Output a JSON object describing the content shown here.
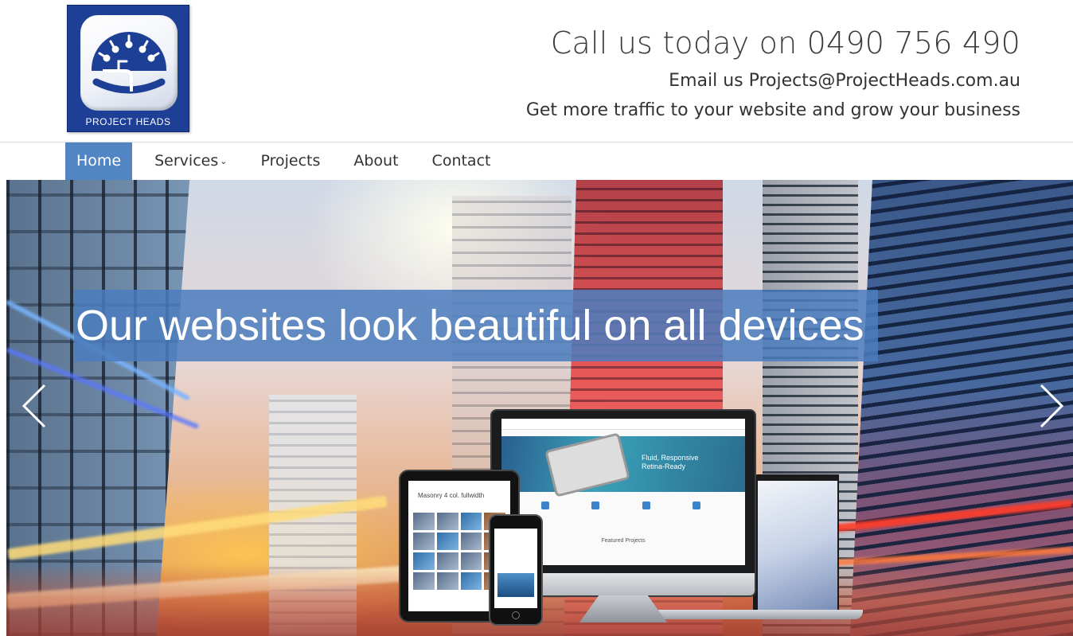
{
  "header": {
    "logo_text": "PROJECT HEADS",
    "phone_line": "Call us today on 0490 756 490",
    "email_line": "Email us Projects@ProjectHeads.com.au",
    "tagline": "Get more traffic to your website and grow your business"
  },
  "nav": {
    "items": [
      {
        "label": "Home",
        "active": true
      },
      {
        "label": "Services",
        "has_dropdown": true
      },
      {
        "label": "Projects"
      },
      {
        "label": "About"
      },
      {
        "label": "Contact"
      }
    ],
    "dropdown_icon": "chevron-down-icon",
    "active_color": "#5185c4"
  },
  "hero": {
    "caption": "Our websites look beautiful on all devices",
    "caption_bg": "#4b7dbe",
    "prev_icon": "chevron-left-icon",
    "next_icon": "chevron-right-icon",
    "mock": {
      "desktop_headline_1": "Fluid, Responsive",
      "desktop_headline_2": "Retina-Ready",
      "desktop_section": "Featured Projects",
      "tablet_title": "Masonry 4 col. fullwidth"
    }
  },
  "colors": {
    "logo_bg": "#1d3f96",
    "text": "#333333"
  }
}
